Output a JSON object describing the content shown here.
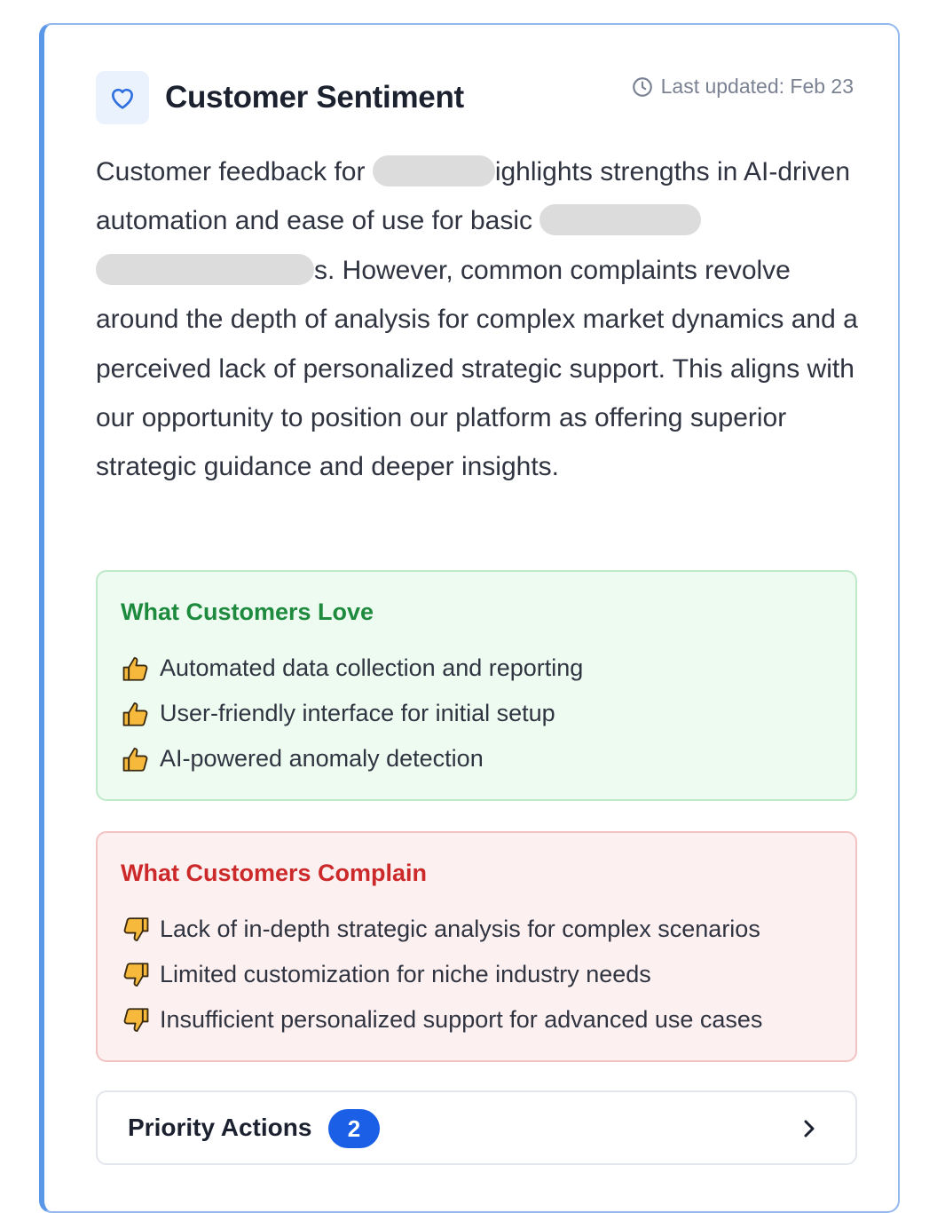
{
  "card": {
    "title": "Customer Sentiment",
    "last_updated": "Last updated: Feb 23",
    "summary": {
      "part1": "Customer feedback for ",
      "part2": "ighlights strengths in AI-driven automation and ease of use for basic ",
      "part3": "s. However, common complaints revolve around the depth of analysis for complex market dynamics and a perceived lack of personalized strategic support. This aligns with our opportunity to position our platform as offering superior strategic guidance and deeper insights."
    },
    "love": {
      "title": "What Customers Love",
      "items": [
        "Automated data collection and reporting",
        "User-friendly interface for initial setup",
        "AI-powered anomaly detection"
      ]
    },
    "complain": {
      "title": "What Customers Complain",
      "items": [
        "Lack of in-depth strategic analysis for complex scenarios",
        "Limited customization for niche industry needs",
        "Insufficient personalized support for advanced use cases"
      ]
    },
    "priority": {
      "label": "Priority Actions",
      "count": "2"
    }
  },
  "colors": {
    "accent_border": "#5b97e8",
    "love_title": "#1e8a3e",
    "love_bg": "#eefbf1",
    "complain_title": "#cc2a2a",
    "complain_bg": "#fdf0f0",
    "badge": "#1a5fe6"
  },
  "icons": {
    "header": "heart-icon",
    "updated": "clock-icon",
    "love_item": "thumbs-up-icon",
    "complain_item": "thumbs-down-icon",
    "priority": "chevron-right-icon"
  }
}
